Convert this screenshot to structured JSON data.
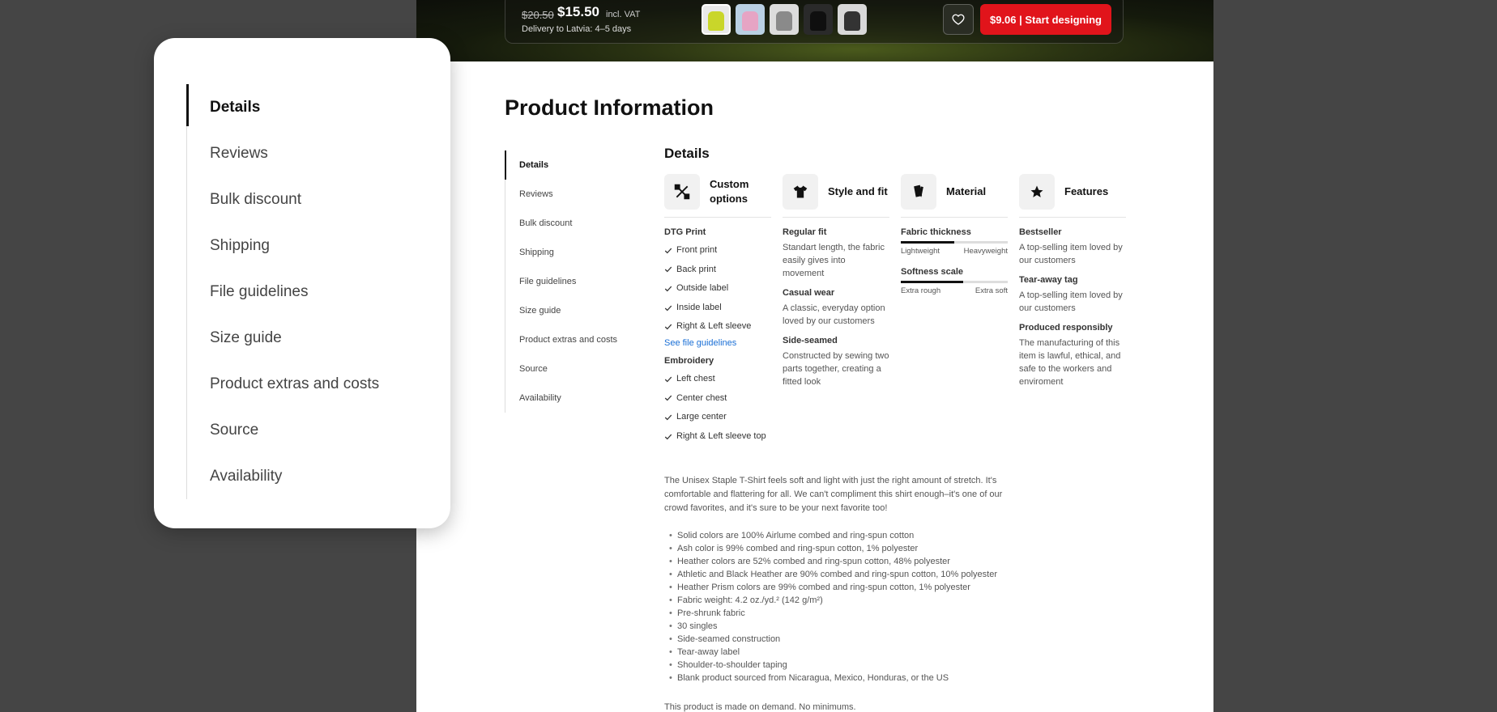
{
  "sticky_bar": {
    "old_price": "$20.50",
    "price": "$15.50",
    "vat": "incl. VAT",
    "delivery": "Delivery to Latvia: 4–5 days",
    "thumbnails": [
      {
        "name": "thumb-yellow-hoodie",
        "bg": "#e9e9e9",
        "color": "#c9d62a"
      },
      {
        "name": "thumb-pink-hoodie",
        "bg": "#b9d0e3",
        "color": "#e6a4c4"
      },
      {
        "name": "thumb-grey-hoodie",
        "bg": "#dcdcdc",
        "color": "#8a8a8a"
      },
      {
        "name": "thumb-black-hoodie",
        "bg": "#2a2a2a",
        "color": "#0f0f0f"
      },
      {
        "name": "thumb-black-outfit",
        "bg": "#d8d8d8",
        "color": "#333333"
      }
    ],
    "favorite_icon": "heart-icon",
    "start_label": "$9.06 | Start designing"
  },
  "page_title": "Product Information",
  "side_nav": [
    "Details",
    "Reviews",
    "Bulk discount",
    "Shipping",
    "File guidelines",
    "Size guide",
    "Product extras and costs",
    "Source",
    "Availability"
  ],
  "details": {
    "title": "Details",
    "custom_options": {
      "title": "Custom options",
      "icon": "tools-icon",
      "dtg_title": "DTG Print",
      "dtg_items": [
        "Front print",
        "Back print",
        "Outside label",
        "Inside label",
        "Right & Left sleeve"
      ],
      "link": "See file guidelines",
      "embroidery_title": "Embroidery",
      "embroidery_items": [
        "Left chest",
        "Center chest",
        "Large center",
        "Right & Left sleeve top"
      ]
    },
    "style_fit": {
      "title": "Style and fit",
      "icon": "tshirt-icon",
      "items": [
        {
          "title": "Regular fit",
          "text": "Standart length, the fabric easily gives into movement"
        },
        {
          "title": "Casual wear",
          "text": "A classic, everyday option loved by our customers"
        },
        {
          "title": "Side-seamed",
          "text": "Constructed by sewing two parts together, creating a fitted look"
        }
      ]
    },
    "material": {
      "title": "Material",
      "icon": "fabric-icon",
      "thickness_title": "Fabric thickness",
      "thickness_level": 0.5,
      "thickness_min": "Lightweight",
      "thickness_max": "Heavyweight",
      "softness_title": "Softness scale",
      "softness_level": 0.58,
      "softness_min": "Extra rough",
      "softness_max": "Extra soft"
    },
    "features": {
      "title": "Features",
      "icon": "star-icon",
      "items": [
        {
          "title": "Bestseller",
          "text": "A top-selling item loved by our customers"
        },
        {
          "title": "Tear-away tag",
          "text": "A top-selling item loved by our customers"
        },
        {
          "title": "Produced responsibly",
          "text": "The manufacturing of this item is lawful, ethical, and safe to the workers and enviroment"
        }
      ]
    }
  },
  "intro": "The Unisex Staple T-Shirt feels soft and light with just the right amount of stretch. It's comfortable and flattering for all. We can't compliment this shirt enough–it's one of our crowd favorites, and it's sure to be your next favorite too!",
  "bullets": [
    "Solid colors are 100% Airlume combed and ring-spun cotton",
    "Ash color is 99% combed and ring-spun cotton, 1% polyester",
    "Heather colors are 52% combed and ring-spun cotton, 48% polyester",
    "Athletic and Black Heather are 90% combed and ring-spun cotton, 10% polyester",
    "Heather Prism colors are 99% combed and ring-spun cotton, 1% polyester",
    "Fabric weight: 4.2 oz./yd.² (142 g/m²)",
    "Pre-shrunk fabric",
    "30 singles",
    "Side-seamed construction",
    "Tear-away label",
    "Shoulder-to-shoulder taping",
    "Blank product sourced from Nicaragua, Mexico, Honduras, or the US"
  ],
  "demand_note": "This product is made on demand. No minimums.",
  "zoom_card_nav": [
    "Details",
    "Reviews",
    "Bulk discount",
    "Shipping",
    "File guidelines",
    "Size guide",
    "Product extras and costs",
    "Source",
    "Availability"
  ],
  "colors": {
    "accent_red": "#e1141b",
    "link_blue": "#1a6fd6"
  }
}
